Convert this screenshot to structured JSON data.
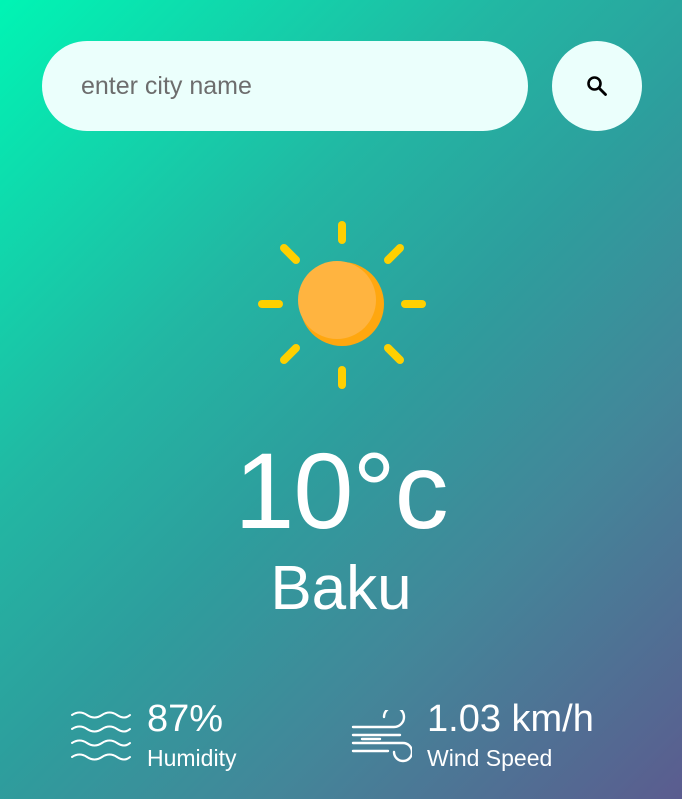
{
  "search": {
    "placeholder": "enter city name",
    "value": "",
    "button_icon": "search-icon"
  },
  "weather": {
    "icon": "sun-icon",
    "temperature": "10°c",
    "city": "Baku"
  },
  "details": {
    "humidity": {
      "icon": "humidity-waves-icon",
      "value": "87%",
      "label": "Humidity"
    },
    "wind": {
      "icon": "wind-icon",
      "value": "1.03 km/h",
      "label": "Wind Speed"
    }
  },
  "colors": {
    "gradient_start": "#00f5b4",
    "gradient_end": "#5b5c8f",
    "input_background": "#ebfffc",
    "sun_rays": "#ffd000",
    "sun_body": "#ffae3b"
  }
}
